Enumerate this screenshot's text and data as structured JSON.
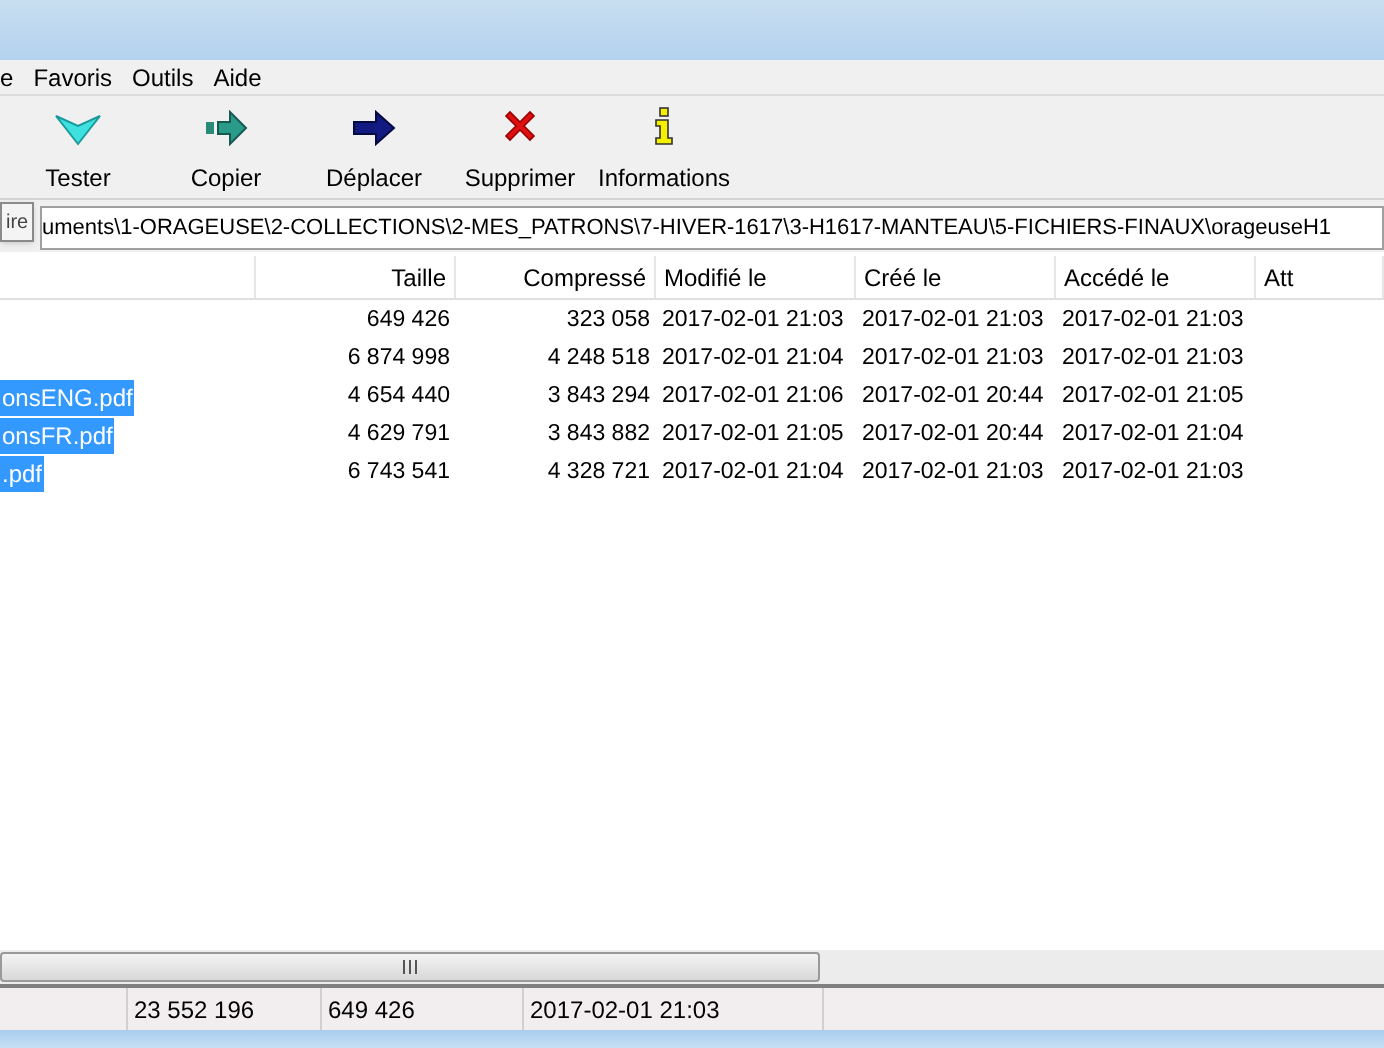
{
  "menu": [
    "e",
    "Favoris",
    "Outils",
    "Aide"
  ],
  "toolbar": [
    {
      "kind": "test",
      "label": "Tester"
    },
    {
      "kind": "copy",
      "label": "Copier"
    },
    {
      "kind": "move",
      "label": "Déplacer"
    },
    {
      "kind": "delete",
      "label": "Supprimer"
    },
    {
      "kind": "info",
      "label": "Informations"
    }
  ],
  "address": {
    "value": "uments\\1-ORAGEUSE\\2-COLLECTIONS\\2-MES_PATRONS\\7-HIVER-1617\\3-H1617-MANTEAU\\5-FICHIERS-FINAUX\\orageuseH1",
    "tooltip": "ire"
  },
  "table": {
    "columns": [
      "Taille",
      "Compressé",
      "Modifié le",
      "Créé le",
      "Accédé le",
      "Att"
    ],
    "rows": [
      {
        "selected": false,
        "cells": [
          "649 426",
          "323 058",
          "2017-02-01 21:03",
          "2017-02-01 21:03",
          "2017-02-01 21:03"
        ]
      },
      {
        "selected": false,
        "cells": [
          "6 874 998",
          "4 248 518",
          "2017-02-01 21:04",
          "2017-02-01 21:03",
          "2017-02-01 21:03"
        ]
      },
      {
        "selected": true,
        "name": "onsENG.pdf",
        "cells": [
          "4 654 440",
          "3 843 294",
          "2017-02-01 21:06",
          "2017-02-01 20:44",
          "2017-02-01 21:05"
        ]
      },
      {
        "selected": true,
        "name": "onsFR.pdf",
        "cells": [
          "4 629 791",
          "3 843 882",
          "2017-02-01 21:05",
          "2017-02-01 20:44",
          "2017-02-01 21:04"
        ]
      },
      {
        "selected": true,
        "name": ".pdf",
        "cells": [
          "6 743 541",
          "4 328 721",
          "2017-02-01 21:04",
          "2017-02-01 21:03",
          "2017-02-01 21:03"
        ]
      }
    ]
  },
  "status_bar": [
    "23 552 196",
    "649 426",
    "2017-02-01 21:03"
  ]
}
